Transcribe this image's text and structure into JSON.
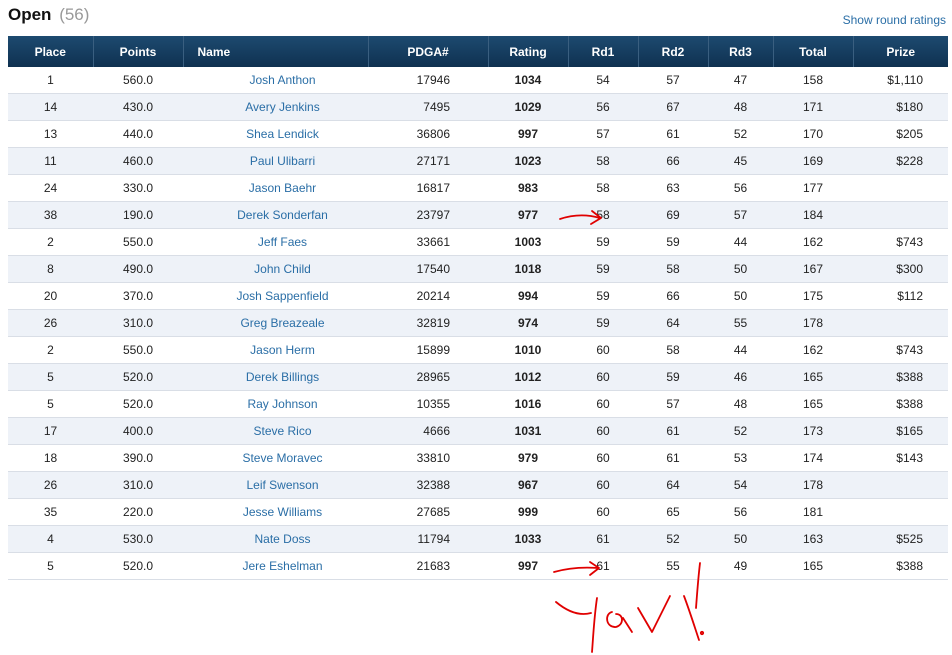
{
  "division": {
    "name": "Open",
    "count": "(56)"
  },
  "show_round_ratings": "Show round ratings",
  "columns": [
    "Place",
    "Points",
    "Name",
    "PDGA#",
    "Rating",
    "Rd1",
    "Rd2",
    "Rd3",
    "Total",
    "Prize"
  ],
  "rows": [
    {
      "place": "1",
      "points": "560.0",
      "name": "Josh Anthon",
      "pdga": "17946",
      "rating": "1034",
      "rd1": "54",
      "rd2": "57",
      "rd3": "47",
      "total": "158",
      "prize": "$1,110"
    },
    {
      "place": "14",
      "points": "430.0",
      "name": "Avery Jenkins",
      "pdga": "7495",
      "rating": "1029",
      "rd1": "56",
      "rd2": "67",
      "rd3": "48",
      "total": "171",
      "prize": "$180"
    },
    {
      "place": "13",
      "points": "440.0",
      "name": "Shea Lendick",
      "pdga": "36806",
      "rating": "997",
      "rd1": "57",
      "rd2": "61",
      "rd3": "52",
      "total": "170",
      "prize": "$205"
    },
    {
      "place": "11",
      "points": "460.0",
      "name": "Paul Ulibarri",
      "pdga": "27171",
      "rating": "1023",
      "rd1": "58",
      "rd2": "66",
      "rd3": "45",
      "total": "169",
      "prize": "$228"
    },
    {
      "place": "24",
      "points": "330.0",
      "name": "Jason Baehr",
      "pdga": "16817",
      "rating": "983",
      "rd1": "58",
      "rd2": "63",
      "rd3": "56",
      "total": "177",
      "prize": ""
    },
    {
      "place": "38",
      "points": "190.0",
      "name": "Derek Sonderfan",
      "pdga": "23797",
      "rating": "977",
      "rd1": "58",
      "rd2": "69",
      "rd3": "57",
      "total": "184",
      "prize": ""
    },
    {
      "place": "2",
      "points": "550.0",
      "name": "Jeff Faes",
      "pdga": "33661",
      "rating": "1003",
      "rd1": "59",
      "rd2": "59",
      "rd3": "44",
      "total": "162",
      "prize": "$743"
    },
    {
      "place": "8",
      "points": "490.0",
      "name": "John Child",
      "pdga": "17540",
      "rating": "1018",
      "rd1": "59",
      "rd2": "58",
      "rd3": "50",
      "total": "167",
      "prize": "$300"
    },
    {
      "place": "20",
      "points": "370.0",
      "name": "Josh Sappenfield",
      "pdga": "20214",
      "rating": "994",
      "rd1": "59",
      "rd2": "66",
      "rd3": "50",
      "total": "175",
      "prize": "$112"
    },
    {
      "place": "26",
      "points": "310.0",
      "name": "Greg Breazeale",
      "pdga": "32819",
      "rating": "974",
      "rd1": "59",
      "rd2": "64",
      "rd3": "55",
      "total": "178",
      "prize": ""
    },
    {
      "place": "2",
      "points": "550.0",
      "name": "Jason Herm",
      "pdga": "15899",
      "rating": "1010",
      "rd1": "60",
      "rd2": "58",
      "rd3": "44",
      "total": "162",
      "prize": "$743"
    },
    {
      "place": "5",
      "points": "520.0",
      "name": "Derek Billings",
      "pdga": "28965",
      "rating": "1012",
      "rd1": "60",
      "rd2": "59",
      "rd3": "46",
      "total": "165",
      "prize": "$388"
    },
    {
      "place": "5",
      "points": "520.0",
      "name": "Ray Johnson",
      "pdga": "10355",
      "rating": "1016",
      "rd1": "60",
      "rd2": "57",
      "rd3": "48",
      "total": "165",
      "prize": "$388"
    },
    {
      "place": "17",
      "points": "400.0",
      "name": "Steve Rico",
      "pdga": "4666",
      "rating": "1031",
      "rd1": "60",
      "rd2": "61",
      "rd3": "52",
      "total": "173",
      "prize": "$165"
    },
    {
      "place": "18",
      "points": "390.0",
      "name": "Steve Moravec",
      "pdga": "33810",
      "rating": "979",
      "rd1": "60",
      "rd2": "61",
      "rd3": "53",
      "total": "174",
      "prize": "$143"
    },
    {
      "place": "26",
      "points": "310.0",
      "name": "Leif Swenson",
      "pdga": "32388",
      "rating": "967",
      "rd1": "60",
      "rd2": "64",
      "rd3": "54",
      "total": "178",
      "prize": ""
    },
    {
      "place": "35",
      "points": "220.0",
      "name": "Jesse Williams",
      "pdga": "27685",
      "rating": "999",
      "rd1": "60",
      "rd2": "65",
      "rd3": "56",
      "total": "181",
      "prize": ""
    },
    {
      "place": "4",
      "points": "530.0",
      "name": "Nate Doss",
      "pdga": "11794",
      "rating": "1033",
      "rd1": "61",
      "rd2": "52",
      "rd3": "50",
      "total": "163",
      "prize": "$525"
    },
    {
      "place": "5",
      "points": "520.0",
      "name": "Jere Eshelman",
      "pdga": "21683",
      "rating": "997",
      "rd1": "61",
      "rd2": "55",
      "rd3": "49",
      "total": "165",
      "prize": "$388"
    }
  ],
  "annotation": {
    "handwriting": "Yay!",
    "color": "#e00000"
  },
  "colors": {
    "header_bg": "#123a5e",
    "link": "#2a6ea6",
    "alt_row": "#eef2f8"
  }
}
